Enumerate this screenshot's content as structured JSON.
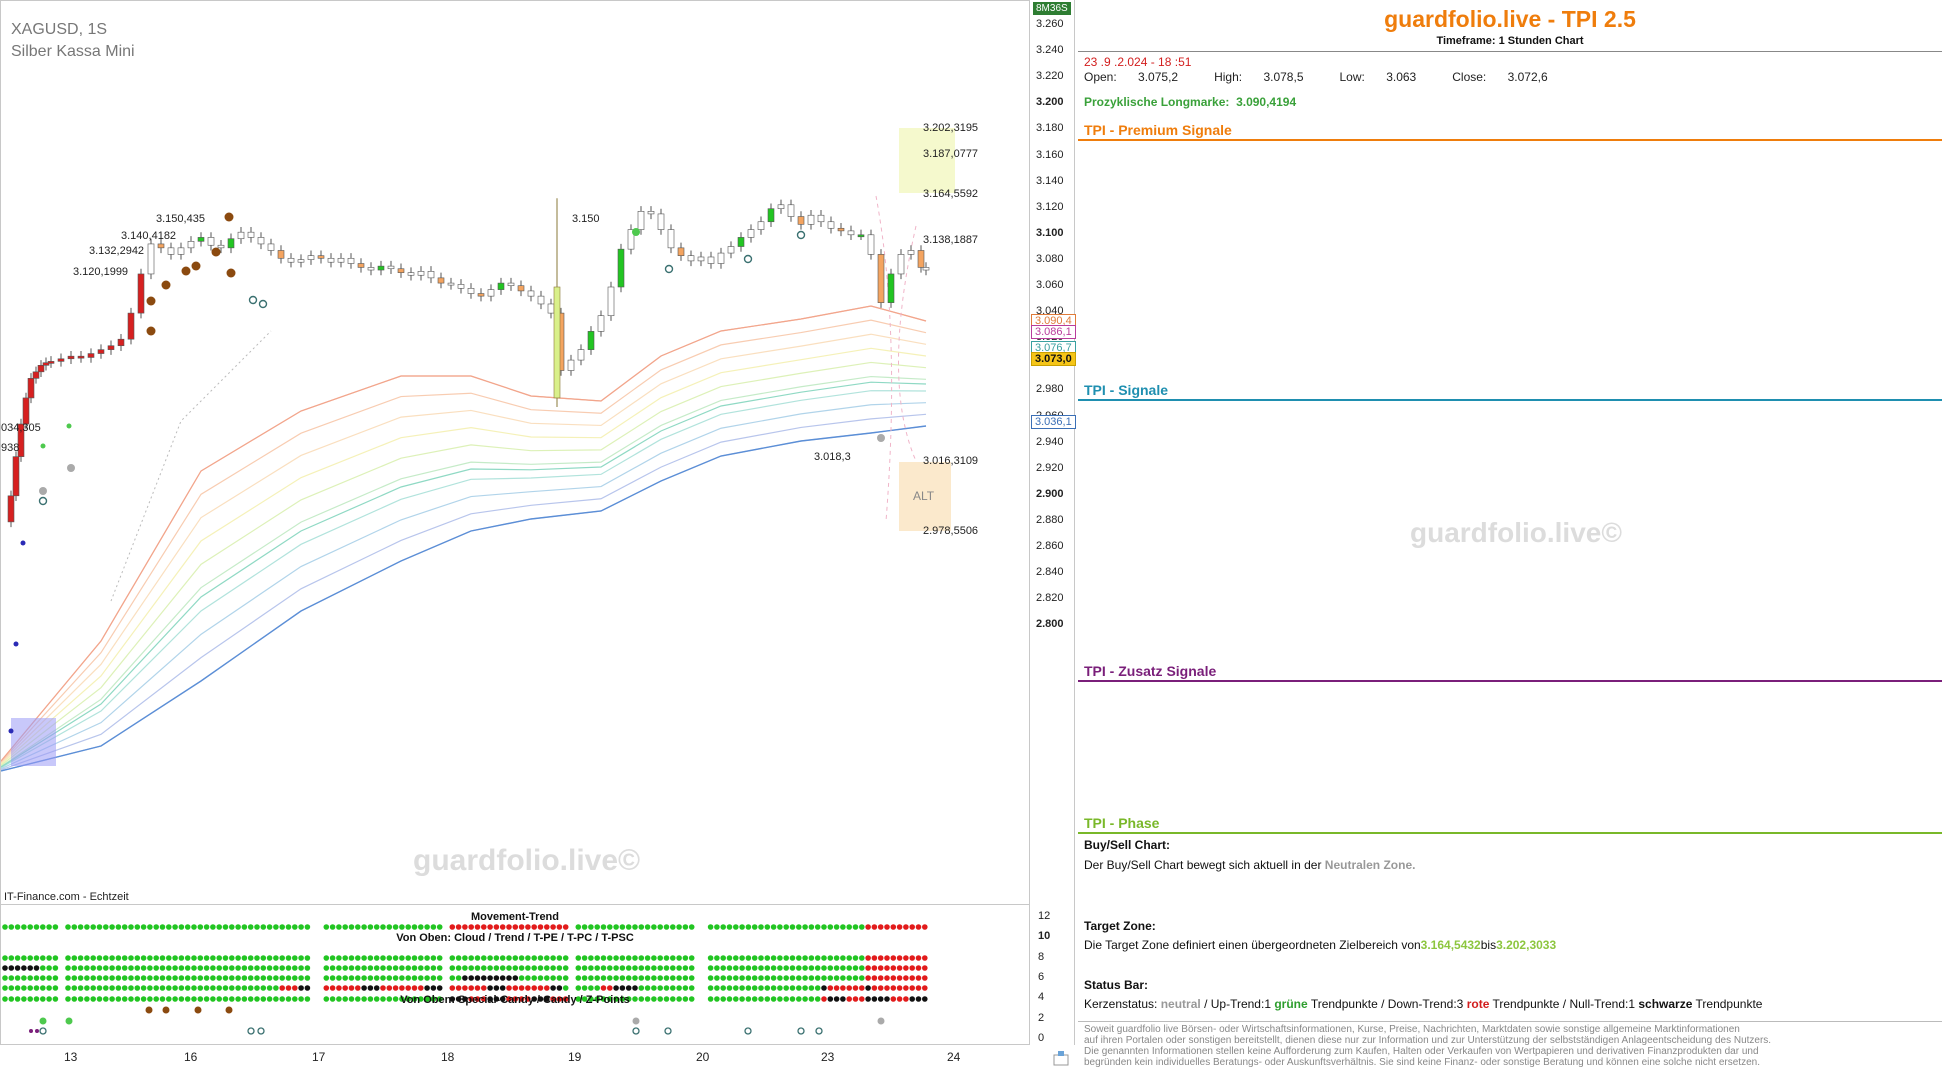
{
  "chart": {
    "symbol": "XAGUSD, 1S",
    "instrument": "Silber Kassa Mini",
    "source": "IT-Finance.com - Echtzeit",
    "watermark": "guardfolio.live©",
    "timeframe_badge": "8M36S",
    "price_ticks": [
      "3.260",
      "3.240",
      "3.220",
      "3.200",
      "3.180",
      "3.160",
      "3.140",
      "3.120",
      "3.100",
      "3.080",
      "3.060",
      "3.040",
      "3.020",
      "3.000",
      "2.980",
      "2.960",
      "2.940",
      "2.920",
      "2.900",
      "2.880",
      "2.860",
      "2.840",
      "2.820",
      "2.800"
    ],
    "price_labels": [
      {
        "text": "3.090,4",
        "color": "#e07b39"
      },
      {
        "text": "3.086,1",
        "color": "#b93c9c"
      },
      {
        "text": "3.076,7",
        "color": "#3aa0a0"
      },
      {
        "text": "3.073,0",
        "color": "#111111",
        "bg": "#f5c518"
      },
      {
        "text": "3.036,1",
        "color": "#3b6fb6"
      }
    ],
    "annotations": [
      {
        "text": "3.150,435",
        "color": "#b8965a"
      },
      {
        "text": "3.140,4182",
        "color": "#b8965a"
      },
      {
        "text": "3.132,2942",
        "color": "#b8965a"
      },
      {
        "text": "3.120,1999",
        "color": "#b8965a"
      },
      {
        "text": "3.150",
        "color": "#c8c8d8"
      },
      {
        "text": "3.018,3",
        "color": "#c8c8d8"
      },
      {
        "text": "034,305",
        "color": "#6a9e6a"
      },
      {
        "text": "938",
        "color": "#6a9e6a"
      },
      {
        "text": "3.202,3195",
        "color": "#999999"
      },
      {
        "text": "3.187,0777",
        "color": "#999999"
      },
      {
        "text": "3.164,5592",
        "color": "#999999"
      },
      {
        "text": "3.138,1887",
        "color": "#e7a7e0"
      },
      {
        "text": "3.016,3109",
        "color": "#c070c0"
      },
      {
        "text": "2.978,5506",
        "color": "#999999"
      }
    ],
    "alt_label": "ALT",
    "time_ticks": [
      "13",
      "16",
      "17",
      "18",
      "19",
      "20",
      "23",
      "24"
    ]
  },
  "indicator": {
    "title_top": "Movement-Trend",
    "title_mid": "Von Oben: Cloud / Trend / T-PE / T-PC / T-PSC",
    "title_bottom": "Von Oben: Special-Candy / Candy / Z-Points",
    "ticks": [
      "12",
      "10",
      "8",
      "6",
      "4",
      "2",
      "0"
    ]
  },
  "panel": {
    "title": "guardfolio.live - TPI 2.5",
    "subtitle": "Timeframe: 1 Stunden Chart",
    "date": "23 .9 .2.024  - 18 :51",
    "ohlc": {
      "open_label": "Open:",
      "open": "3.075,2",
      "high_label": "High:",
      "high": "3.078,5",
      "low_label": "Low:",
      "low": "3.063",
      "close_label": "Close:",
      "close": "3.072,6"
    },
    "long_label": "Prozyklische Longmarke:",
    "long_value": "3.090,4194",
    "sections": [
      {
        "title": "TPI - Premium Signale",
        "color": "#ef7d0c"
      },
      {
        "title": "TPI - Signale",
        "color": "#1f8fb0"
      },
      {
        "title": "TPI - Zusatz Signale",
        "color": "#7a1f7a"
      },
      {
        "title": "TPI - Phase",
        "color": "#79b829"
      }
    ],
    "watermark": "guardfolio.live©",
    "buy_sell_title": "Buy/Sell Chart:",
    "buy_sell_text": "Der Buy/Sell Chart bewegt sich aktuell in der ",
    "buy_sell_zone": "Neutralen Zone.",
    "target_title": "Target Zone:",
    "target_text": "Die Target Zone definiert einen übergeordneten Zielbereich von",
    "target_from": "3.164,5432",
    "target_mid": "bis",
    "target_to": "3.202,3033",
    "status_title": "Status Bar:",
    "status": {
      "k_label": "Kerzenstatus: ",
      "k_value": "neutral",
      "up_label": "  / Up-Trend:",
      "up_count": "1",
      "up_word": "grüne",
      "up_tail": "Trendpunkte",
      "down_label": "  / Down-Trend:",
      "down_count": "3",
      "down_word": "rote",
      "down_tail": "Trendpunkte",
      "null_label": " / Null-Trend:",
      "null_count": "1",
      "null_word": "schwarze",
      "null_tail": "Trendpunkte"
    },
    "disclaimer": [
      "Soweit guardfolio live Börsen- oder Wirtschaftsinformationen, Kurse, Preise, Nachrichten, Marktdaten sowie sonstige allgemeine Marktinformationen",
      "auf ihren Portalen oder sonstigen bereitstellt, dienen diese nur zur Information und zur Unterstützung der selbstständigen Anlageentscheidung des Nutzers.",
      "Die genannten Informationen stellen keine Aufforderung zum Kaufen, Halten oder Verkaufen von Wertpapieren und derivativen Finanzprodukten dar und",
      "begründen kein individuelles Beratungs- oder Auskunftsverhältnis. Sie sind keine Finanz- oder sonstige Beratung und können eine solche nicht ersetzen."
    ]
  }
}
